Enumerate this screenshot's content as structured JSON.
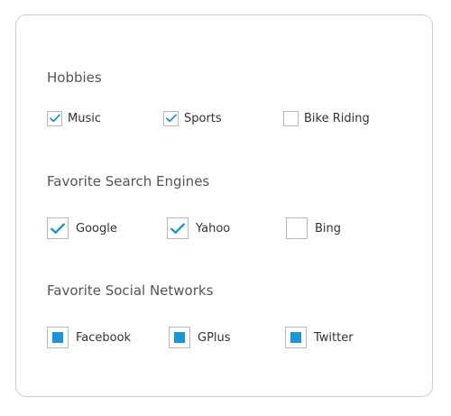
{
  "accent_color": "#1a95d8",
  "hobbies": {
    "title": "Hobbies",
    "options": [
      {
        "label": "Music",
        "checked": true
      },
      {
        "label": "Sports",
        "checked": true
      },
      {
        "label": "Bike Riding",
        "checked": false
      }
    ]
  },
  "search_engines": {
    "title": "Favorite Search Engines",
    "options": [
      {
        "label": "Google",
        "checked": true
      },
      {
        "label": "Yahoo",
        "checked": true
      },
      {
        "label": "Bing",
        "checked": false
      }
    ]
  },
  "social_networks": {
    "title": "Favorite Social Networks",
    "options": [
      {
        "label": "Facebook",
        "checked": true
      },
      {
        "label": "GPlus",
        "checked": true
      },
      {
        "label": "Twitter",
        "checked": true
      }
    ]
  }
}
